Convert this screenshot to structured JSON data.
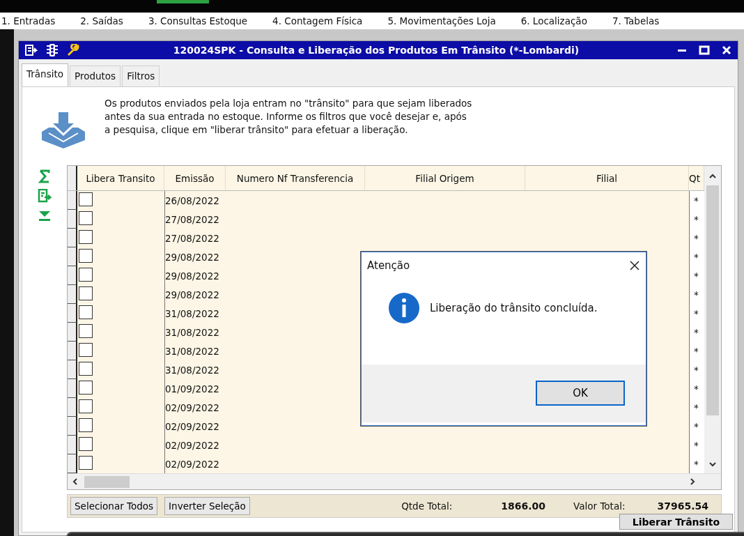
{
  "menu": [
    {
      "label": "1. Entradas"
    },
    {
      "label": "2. Saídas"
    },
    {
      "label": "3. Consultas Estoque"
    },
    {
      "label": "4. Contagem Física"
    },
    {
      "label": "5. Movimentações Loja"
    },
    {
      "label": "6. Localização"
    },
    {
      "label": "7. Tabelas"
    }
  ],
  "window": {
    "title": "120024SPK - Consulta e Liberação dos Produtos Em Trânsito (*-Lombardi)"
  },
  "tabs": [
    {
      "label": "Trânsito",
      "selected": true
    },
    {
      "label": "Produtos",
      "selected": false
    },
    {
      "label": "Filtros",
      "selected": false
    }
  ],
  "description": [
    "Os produtos enviados pela loja entram no \"trânsito\" para que sejam liberados",
    "antes da sua entrada no estoque. Informe os filtros que você desejar e, após",
    "a pesquisa, clique em \"liberar trânsito\" para efetuar a liberação."
  ],
  "table": {
    "columns": [
      "Libera Transito",
      "Emissão",
      "Numero Nf Transferencia",
      "Filial Origem",
      "Filial",
      "Qt"
    ],
    "rows": [
      {
        "checked": false,
        "emissao": "26/08/2022",
        "qt": "*"
      },
      {
        "checked": false,
        "emissao": "27/08/2022",
        "qt": "*"
      },
      {
        "checked": false,
        "emissao": "27/08/2022",
        "qt": "*"
      },
      {
        "checked": false,
        "emissao": "29/08/2022",
        "qt": "*"
      },
      {
        "checked": false,
        "emissao": "29/08/2022",
        "qt": "*"
      },
      {
        "checked": false,
        "emissao": "29/08/2022",
        "qt": "*"
      },
      {
        "checked": false,
        "emissao": "31/08/2022",
        "qt": "*"
      },
      {
        "checked": false,
        "emissao": "31/08/2022",
        "qt": "*"
      },
      {
        "checked": false,
        "emissao": "31/08/2022",
        "qt": "*"
      },
      {
        "checked": false,
        "emissao": "31/08/2022",
        "qt": "*"
      },
      {
        "checked": false,
        "emissao": "01/09/2022",
        "qt": "*"
      },
      {
        "checked": false,
        "emissao": "02/09/2022",
        "qt": "*"
      },
      {
        "checked": false,
        "emissao": "02/09/2022",
        "qt": "*"
      },
      {
        "checked": false,
        "emissao": "02/09/2022",
        "qt": "*"
      },
      {
        "checked": false,
        "emissao": "02/09/2022",
        "qt": "*"
      }
    ]
  },
  "footer": {
    "buttons": [
      {
        "label": "Selecionar Todos"
      },
      {
        "label": "Inverter Seleção"
      }
    ],
    "qtde_label": "Qtde Total:",
    "qtde_value": "1866.00",
    "valor_label": "Valor Total:",
    "valor_value": "37965.54"
  },
  "action_button": "Liberar Trânsito",
  "dialog": {
    "title": "Atenção",
    "message": "Liberação do trânsito concluída.",
    "button": "OK"
  }
}
